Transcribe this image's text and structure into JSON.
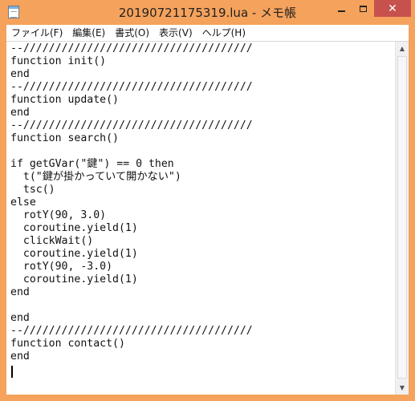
{
  "window": {
    "title": "20190721175319.lua - メモ帳",
    "min_label": "",
    "max_label": "",
    "close_label": "✕"
  },
  "menu": {
    "file": "ファイル(F)",
    "edit": "編集(E)",
    "format": "書式(O)",
    "view": "表示(V)",
    "help": "ヘルプ(H)"
  },
  "editor": {
    "content": "--////////////////////////////////////\nfunction init()\nend\n--////////////////////////////////////\nfunction update()\nend\n--////////////////////////////////////\nfunction search()\n\nif getGVar(\"鍵\") == 0 then\n  t(\"鍵が掛かっていて開かない\")\n  tsc()\nelse\n  rotY(90, 3.0)\n  coroutine.yield(1)\n  clickWait()\n  coroutine.yield(1)\n  rotY(90, -3.0)\n  coroutine.yield(1)\nend\n\nend\n--////////////////////////////////////\nfunction contact()\nend\n"
  },
  "icons": {
    "app": "notepad-icon",
    "scroll_up": "arrow-up-icon",
    "scroll_down": "arrow-down-icon"
  },
  "colors": {
    "frame": "#f5a25c",
    "close_button": "#c7514d"
  }
}
